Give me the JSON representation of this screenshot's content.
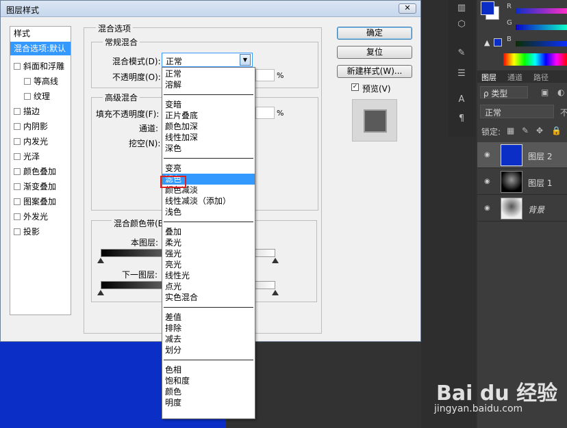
{
  "dialog": {
    "title": "图层样式",
    "close_label": "✕",
    "style_list": [
      {
        "label": "样式",
        "checkbox": false,
        "indent": false,
        "selected": false
      },
      {
        "label": "混合选项:默认",
        "checkbox": false,
        "indent": false,
        "selected": true
      },
      {
        "label": "斜面和浮雕",
        "checkbox": true,
        "indent": false,
        "selected": false
      },
      {
        "label": "等高线",
        "checkbox": true,
        "indent": true,
        "selected": false
      },
      {
        "label": "纹理",
        "checkbox": true,
        "indent": true,
        "selected": false
      },
      {
        "label": "描边",
        "checkbox": true,
        "indent": false,
        "selected": false
      },
      {
        "label": "内阴影",
        "checkbox": true,
        "indent": false,
        "selected": false
      },
      {
        "label": "内发光",
        "checkbox": true,
        "indent": false,
        "selected": false
      },
      {
        "label": "光泽",
        "checkbox": true,
        "indent": false,
        "selected": false
      },
      {
        "label": "颜色叠加",
        "checkbox": true,
        "indent": false,
        "selected": false
      },
      {
        "label": "渐变叠加",
        "checkbox": true,
        "indent": false,
        "selected": false
      },
      {
        "label": "图案叠加",
        "checkbox": true,
        "indent": false,
        "selected": false
      },
      {
        "label": "外发光",
        "checkbox": true,
        "indent": false,
        "selected": false
      },
      {
        "label": "投影",
        "checkbox": true,
        "indent": false,
        "selected": false
      }
    ],
    "blend_options_title": "混合选项",
    "general_blending": "常规混合",
    "blend_mode_label": "混合模式(D):",
    "blend_mode_value": "正常",
    "opacity_label": "不透明度(O):",
    "percent": "%",
    "advanced_blending": "高级混合",
    "fill_opacity_label": "填充不透明度(F):",
    "channels_label": "通道:",
    "knockout_label": "挖空(N):",
    "blend_if_label": "混合颜色带(E",
    "this_layer_label": "本图层:",
    "underlying_layer_label": "下一图层:",
    "buttons": {
      "ok": "确定",
      "reset": "复位",
      "new_style": "新建样式(W)...",
      "preview": "预览(V)"
    },
    "preview_checked": "✓"
  },
  "blend_menu": {
    "groups": [
      [
        "正常",
        "溶解"
      ],
      [
        "变暗",
        "正片叠底",
        "颜色加深",
        "线性加深",
        "深色"
      ],
      [
        "变亮",
        "滤色",
        "颜色减淡",
        "线性减淡（添加）",
        "浅色"
      ],
      [
        "叠加",
        "柔光",
        "强光",
        "亮光",
        "线性光",
        "点光",
        "实色混合"
      ],
      [
        "差值",
        "排除",
        "减去",
        "划分"
      ],
      [
        "色相",
        "饱和度",
        "颜色",
        "明度"
      ]
    ],
    "highlighted": "滤色"
  },
  "color_panel": {
    "fg_color": "#0b2ec7",
    "channels": [
      "R",
      "G",
      "B"
    ]
  },
  "layers_panel": {
    "tabs": [
      "图层",
      "通道",
      "路径"
    ],
    "filter_label": "ρ 类型",
    "blend_mode": "正常",
    "opacity_prefix": "不",
    "lock_label": "锁定:",
    "layers": [
      {
        "name": "图层 2",
        "active": true
      },
      {
        "name": "图层 1",
        "active": false
      },
      {
        "name": "背景",
        "active": false
      }
    ]
  },
  "watermark": {
    "brand": "Bai du 经验",
    "url": "jingyan.baidu.com"
  }
}
